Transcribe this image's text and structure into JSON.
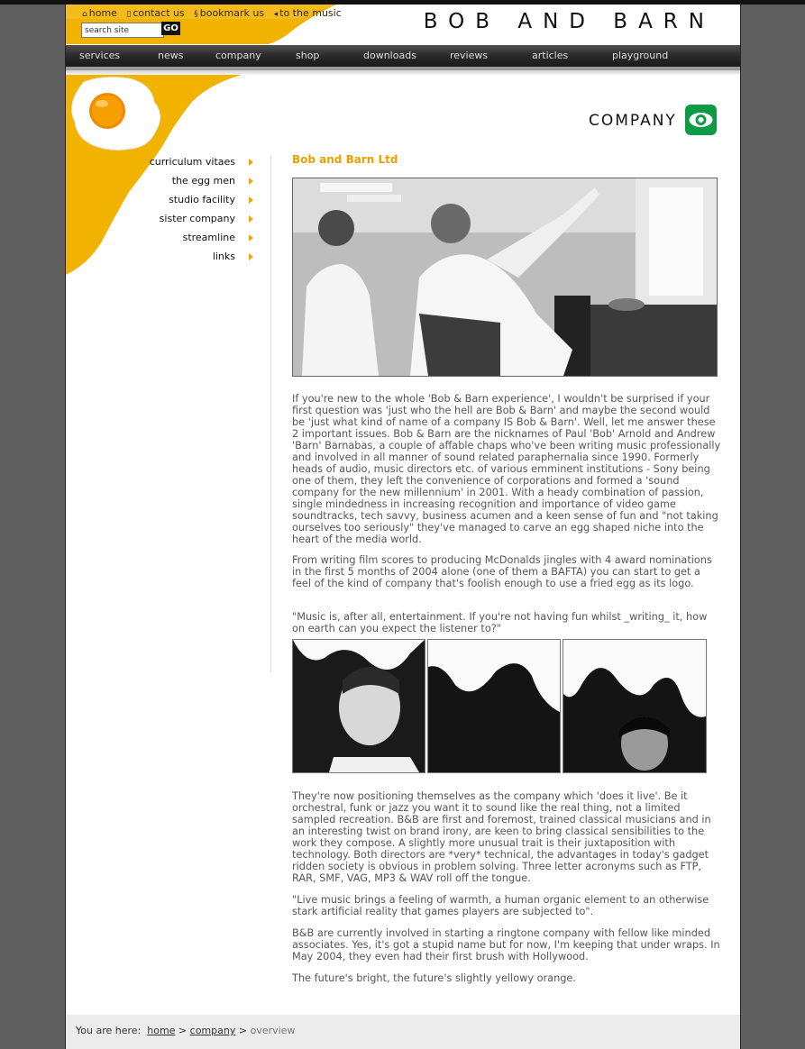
{
  "header": {
    "util_links": [
      {
        "icon": "home-icon",
        "label": "home"
      },
      {
        "icon": "contact-icon",
        "label": "contact us"
      },
      {
        "icon": "bookmark-icon",
        "label": "bookmark us"
      },
      {
        "icon": "speaker-icon",
        "label": "to the music"
      }
    ],
    "search": {
      "placeholder": "search site",
      "value": "search site",
      "go_label": "GO"
    },
    "brand": "BOB AND BARN"
  },
  "nav": {
    "items": [
      "services",
      "news",
      "company",
      "shop",
      "downloads",
      "reviews",
      "articles",
      "playground"
    ]
  },
  "section": {
    "title": "COMPANY",
    "icon": "eye-logo-icon"
  },
  "sidenav": {
    "items": [
      "curriculum vitaes",
      "the egg men",
      "studio facility",
      "sister company",
      "streamline",
      "links"
    ]
  },
  "content": {
    "title": "Bob and Barn Ltd",
    "paragraphs": [
      "If you're new to the whole 'Bob & Barn experience', I wouldn't be surprised if your first question was 'just who the hell are Bob & Barn' and maybe the second would be 'just what kind of name of a company IS Bob & Barn'. Well, let me answer these 2 important issues. Bob & Barn are the nicknames of Paul 'Bob' Arnold and Andrew 'Barn' Barnabas, a couple of affable chaps who've been writing music professionally and involved in all manner of sound related paraphernalia since 1990. Formerly heads of audio, music directors etc. of various emminent institutions - Sony being one of them, they left the convenience of corporations and formed a 'sound company for the new millennium' in 2001. With a heady combination of passion, single mindedness in increasing recognition and importance of video game soundtracks, tech savvy, business acumen and a keen sense of fun and \"not taking ourselves too seriously\" they've managed to carve an egg shaped niche into the heart of the media world.",
      "From writing film scores to producing McDonalds jingles with 4 award nominations in the first 5 months of 2004 alone (one of them a BAFTA) you can start to get a feel of the kind of company that's foolish enough to use a fried egg as its logo.",
      "\"Music is, after all, entertainment. If you're not having fun whilst _writing_ it, how on earth can you expect the listener to?\"",
      "They're now positioning themselves as the company which 'does it live'. Be it orchestral, funk or jazz you want it to sound like the real thing, not a limited sampled recreation. B&B are first and foremost, trained classical musicians and in an interesting twist on brand irony, are keen to bring classical sensibilities to the work they compose. A slightly more unusual trait is their juxtaposition with technology. Both directors are *very* technical, the advantages in today's gadget ridden society is obvious in problem solving. Three letter acronyms such as FTP, RAR, SMF, VAG, MP3 & WAV roll off the tongue.",
      "\"Live music brings a feeling of warmth, a human organic element to an otherwise stark artificial reality that games players are subjected to\".",
      "B&B are currently involved in starting a ringtone company with fellow like minded associates. Yes, it's got a stupid name but for now, I'm keeping that under wraps. In May 2004, they even had their first brush with Hollywood.",
      "The future's bright, the future's slightly yellowy orange."
    ]
  },
  "breadcrumb": {
    "prefix": "You are here:",
    "items": [
      "home",
      "company"
    ],
    "separator": ">",
    "current": "overview"
  },
  "colors": {
    "accent": "#f0a800",
    "title": "#e8a000",
    "nav_bg": "#2a2a2a",
    "text": "#555555"
  }
}
